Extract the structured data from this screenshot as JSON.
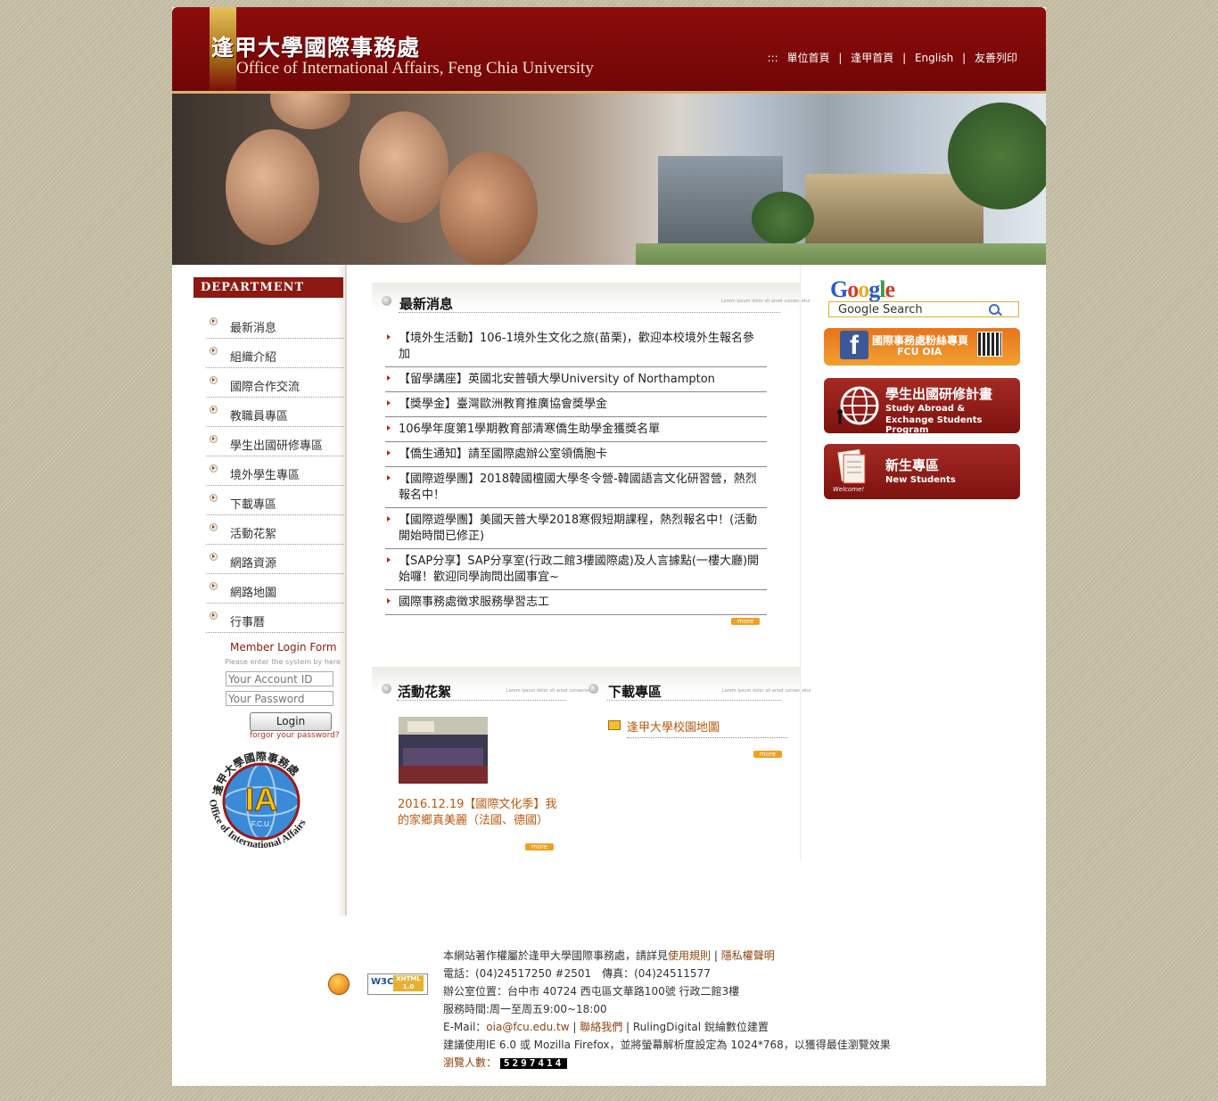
{
  "header": {
    "title_zh": "逢甲大學國際事務處",
    "title_en": "Office of International Affairs, Feng Chia University",
    "prefix": ":::",
    "links": [
      "單位首頁",
      "逢甲首頁",
      "English",
      "友善列印"
    ],
    "separator": "|"
  },
  "sidebar": {
    "menu_title": "DEPARTMENT MENU",
    "items": [
      "最新消息",
      "組織介紹",
      "國際合作交流",
      "教職員專區",
      "學生出國研修專區",
      "境外學生專區",
      "下載專區",
      "活動花絮",
      "網路資源",
      "網路地圖",
      "行事曆"
    ],
    "login": {
      "title": "Member Login Form",
      "subtitle": "Please enter the system by here",
      "account_placeholder": "Your Account ID",
      "password_placeholder": "Your Password",
      "button": "Login",
      "forgot": "forgor your password?"
    },
    "seal": {
      "text_zh": "逢甲大學國際事務處",
      "text_en": "Office of International Affairs",
      "abbr": "IA",
      "sub": "F.C.U."
    }
  },
  "news": {
    "title": "最新消息",
    "tagline": "Lorem ipsum dolor sit amet consectetur",
    "items": [
      "【境外生活動】106-1境外生文化之旅(苗栗)，歡迎本校境外生報名參加",
      "【留學講座】英國北安普頓大學University of Northampton",
      "【獎學金】臺灣歐洲教育推廣協會獎學金",
      "106學年度第1學期教育部清寒僑生助學金獲獎名單",
      "【僑生通知】請至國際處辦公室領僑胞卡",
      "【國際遊學團】2018韓國檀國大學冬令營-韓國語言文化研習營，熱烈報名中！",
      "【國際遊學團】美國天普大學2018寒假短期課程，熱烈報名中！(活動開始時間已修正)",
      "【SAP分享】SAP分享室(行政二館3樓國際處)及人言據點(一樓大廳)開始囉！歡迎同學詢問出國事宜~",
      "國際事務處徵求服務學習志工"
    ],
    "more": "more"
  },
  "activities": {
    "title": "活動花絮",
    "tagline": "Lorem ipsum dolor sit amet consectetur",
    "caption": "2016.12.19【國際文化季】我的家鄉真美麗（法國、德國）",
    "more": "more"
  },
  "downloads": {
    "title": "下載專區",
    "tagline": "Lorem ipsum dolor sit amet consectetur",
    "items": [
      "逢甲大學校園地圖"
    ],
    "more": "more"
  },
  "right": {
    "google": "Google",
    "search_placeholder": "Google Search",
    "fb": {
      "title": "國際事務處粉絲專頁",
      "sub": "FCU OIA"
    },
    "study_abroad": {
      "title": "學生出國研修計畫",
      "sub1": "Study Abroad &",
      "sub2": "Exchange Students Program"
    },
    "new_students": {
      "title": "新生專區",
      "sub": "New Students",
      "welcome": "Welcome!"
    }
  },
  "footer": {
    "line1_prefix": "本網站著作權屬於逢甲大學國際事務處，請詳見",
    "terms": "使用規則",
    "privacy": "隱私權聲明",
    "phone": "電話：(04)24517250 #2501　傳真：(04)24511577",
    "address": "辦公室位置：台中市 40724 西屯區文華路100號 行政二館3樓",
    "hours": "服務時間:周一至周五9:00~18:00",
    "email_label": "E-Mail：",
    "email": "oia@fcu.edu.tw",
    "contact": "聯絡我們",
    "builder": "RulingDigital 銳綸數位建置",
    "browser_note": "建議使用IE 6.0 或 Mozilla Firefox，並將螢幕解析度設定為 1024*768，以獲得最佳瀏覽效果",
    "visitors_label": "瀏覽人數：",
    "visitors": "5297414",
    "w3c": "W3C",
    "xhtml": "XHTML 1.0"
  },
  "colors": {
    "brand_red": "#8c1a12",
    "header_red": "#7f0909",
    "accent_orange": "#f0a020",
    "page_bg": "#c6bea6"
  }
}
